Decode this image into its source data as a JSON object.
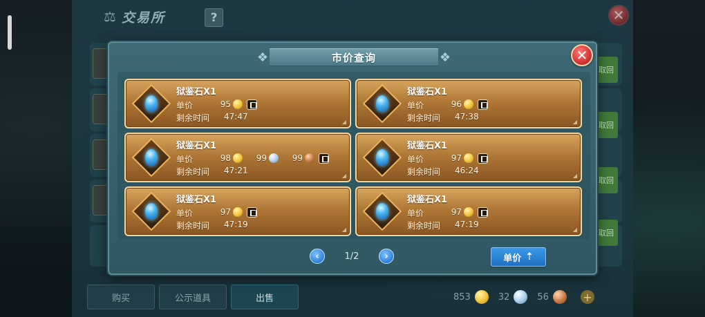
{
  "background": {
    "title": "交易所",
    "help_label": "?",
    "tabs": [
      "购买",
      "公示道具",
      "出售"
    ],
    "active_tab": "出售",
    "get_label": "取回",
    "currency": [
      {
        "value": "853",
        "coin": "gold"
      },
      {
        "value": "32",
        "coin": "silver"
      },
      {
        "value": "56",
        "coin": "copper"
      }
    ],
    "add_label": "+"
  },
  "modal": {
    "title": "市价查询",
    "close_label": "✕",
    "price_label": "单价",
    "time_label": "剩余时间",
    "listings": [
      {
        "name": "狱鉴石X1",
        "prices": [
          {
            "value": "95",
            "coin": "gold"
          }
        ],
        "time": "47:47"
      },
      {
        "name": "狱鉴石X1",
        "prices": [
          {
            "value": "96",
            "coin": "gold"
          }
        ],
        "time": "47:38"
      },
      {
        "name": "狱鉴石X1",
        "prices": [
          {
            "value": "98",
            "coin": "gold"
          },
          {
            "value": "99",
            "coin": "silver"
          },
          {
            "value": "99",
            "coin": "copper"
          }
        ],
        "time": "47:21"
      },
      {
        "name": "狱鉴石X1",
        "prices": [
          {
            "value": "97",
            "coin": "gold"
          }
        ],
        "time": "46:24"
      },
      {
        "name": "狱鉴石X1",
        "prices": [
          {
            "value": "97",
            "coin": "gold"
          }
        ],
        "time": "47:19"
      },
      {
        "name": "狱鉴石X1",
        "prices": [
          {
            "value": "97",
            "coin": "gold"
          }
        ],
        "time": "47:19"
      }
    ],
    "pager": {
      "page": "1/2",
      "prev": "‹",
      "next": "›"
    },
    "sort_button": {
      "label": "单价",
      "icon": "sort-up-icon"
    }
  }
}
